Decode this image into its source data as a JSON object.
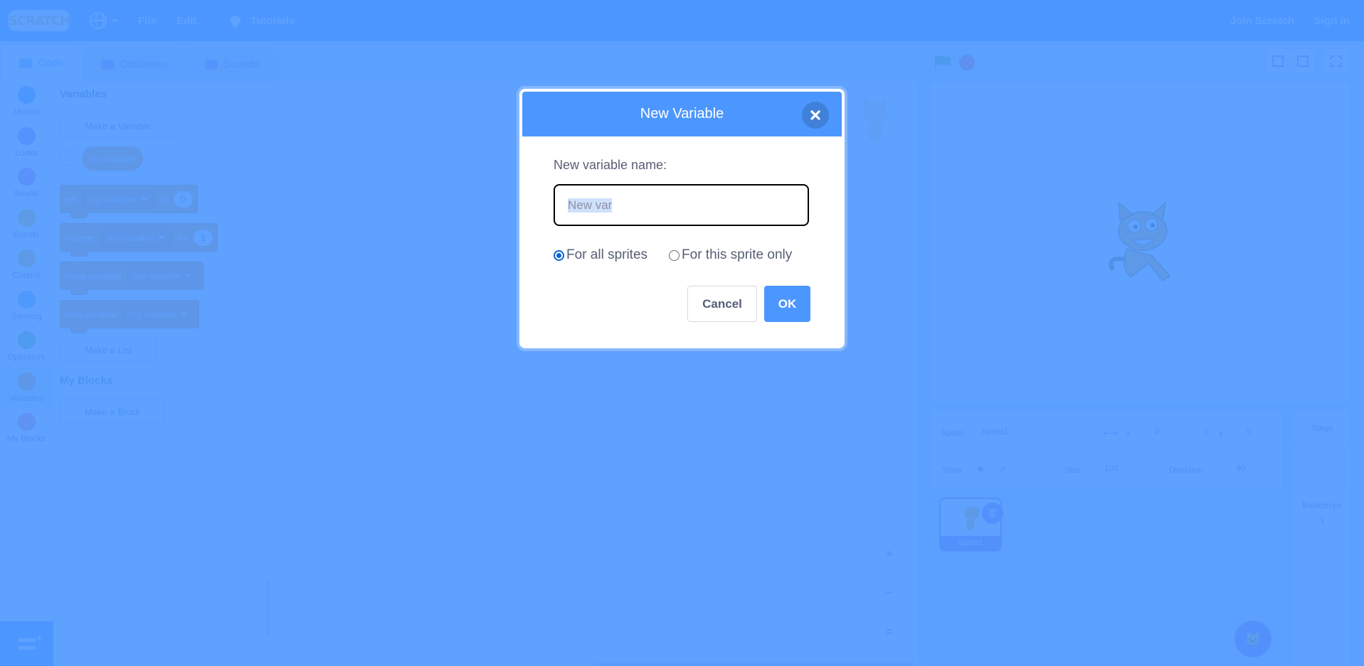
{
  "menubar": {
    "logo": "SCRATCH",
    "file": "File",
    "edit": "Edit",
    "tutorials": "Tutorials",
    "join": "Join Scratch",
    "sign_in": "Sign in"
  },
  "tabs": [
    {
      "label": "Code",
      "icon": "code-icon",
      "active": true
    },
    {
      "label": "Costumes",
      "icon": "brush-icon",
      "active": false
    },
    {
      "label": "Sounds",
      "icon": "speaker-icon",
      "active": false
    }
  ],
  "categories": [
    {
      "label": "Motion",
      "color": "#4c97ff"
    },
    {
      "label": "Looks",
      "color": "#9966ff"
    },
    {
      "label": "Sound",
      "color": "#cf63cf"
    },
    {
      "label": "Events",
      "color": "#ffbf00"
    },
    {
      "label": "Control",
      "color": "#ffab19"
    },
    {
      "label": "Sensing",
      "color": "#5cb1d6"
    },
    {
      "label": "Operators",
      "color": "#59c059"
    },
    {
      "label": "Variables",
      "color": "#ff8c1a"
    },
    {
      "label": "My Blocks",
      "color": "#ff6680"
    }
  ],
  "palette": {
    "variables_heading": "Variables",
    "make_variable": "Make a Variable",
    "variable_reporter": "my variable",
    "set_block": {
      "verb": "set",
      "var": "my variable",
      "prep": "to",
      "value": "0"
    },
    "change_block": {
      "verb": "change",
      "var": "my variable",
      "prep": "by",
      "value": "1"
    },
    "show_block": {
      "verb": "show variable",
      "var": "my variable"
    },
    "hide_block": {
      "verb": "hide variable",
      "var": "my variable"
    },
    "make_list": "Make a List",
    "my_blocks_heading": "My Blocks",
    "make_block": "Make a Block"
  },
  "workspace": {
    "zoom_in": "+",
    "zoom_out": "−",
    "zoom_reset": "="
  },
  "sprite_info": {
    "sprite_label": "Sprite",
    "sprite_name": "Sprite1",
    "x_label": "x",
    "x_value": "0",
    "y_label": "y",
    "y_value": "0",
    "show_label": "Show",
    "size_label": "Size",
    "size_value": "100",
    "direction_label": "Direction",
    "direction_value": "90"
  },
  "sprite_list": [
    {
      "name": "Sprite1",
      "selected": true
    }
  ],
  "stage_panel": {
    "label": "Stage",
    "backdrops_label": "Backdrops",
    "backdrops_count": "1"
  },
  "modal": {
    "title": "New Variable",
    "field_label": "New variable name:",
    "input_value": "New var",
    "radio_all": "For all sprites",
    "radio_this": "For this sprite only",
    "selected_scope": "all",
    "cancel": "Cancel",
    "ok": "OK"
  },
  "colors": {
    "primary": "#4c97ff",
    "variables": "#ff8c1a",
    "accent": "#855cd6",
    "text": "#575e75"
  }
}
